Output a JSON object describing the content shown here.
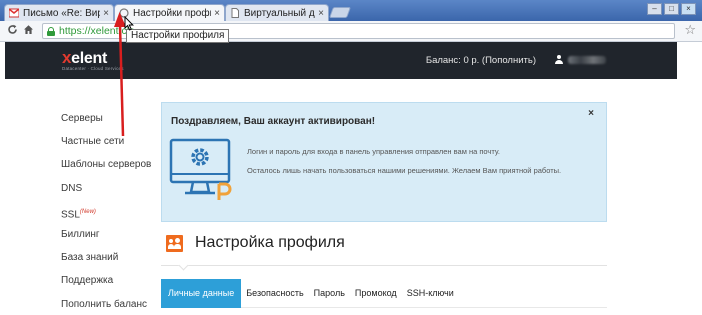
{
  "browser": {
    "tabs": [
      {
        "label": "Письмо «Re: Виртуа",
        "close": "×",
        "active": false
      },
      {
        "label": "Настройки профил",
        "close": "×",
        "active": true
      },
      {
        "label": "Виртуальный дата",
        "close": "×",
        "active": false
      }
    ],
    "window_buttons": {
      "minimize": "–",
      "maximize": "□",
      "close": "×"
    },
    "url": "https://xelent.clo",
    "tooltip": "Настройки профиля"
  },
  "site": {
    "logo_text": "elent",
    "logo_mark": "x",
    "logo_tagline": "Datacenter · Cloud Services",
    "balance_text": "Баланс: 0 р. (Пополнить)"
  },
  "sidebar": {
    "items": [
      {
        "label": "Серверы"
      },
      {
        "label": "Частные сети"
      },
      {
        "label": "Шаблоны серверов"
      },
      {
        "label": "DNS"
      },
      {
        "label": "SSL",
        "badge": "(New)"
      },
      {
        "label": "Биллинг"
      },
      {
        "label": "База знаний"
      },
      {
        "label": "Поддержка"
      },
      {
        "label": "Пополнить баланс"
      }
    ]
  },
  "alert": {
    "title": "Поздравляем, Ваш аккаунт активирован!",
    "close": "×",
    "line1": "Логин и пароль для входа в панель управления отправлен вам на почту.",
    "line2": "Осталось лишь начать пользоваться нашими решениями. Желаем Вам приятной работы."
  },
  "profile": {
    "title": "Настройка профиля",
    "tabs": [
      {
        "label": "Личные данные",
        "active": true
      },
      {
        "label": "Безопасность",
        "active": false
      },
      {
        "label": "Пароль",
        "active": false
      },
      {
        "label": "Промокод",
        "active": false
      },
      {
        "label": "SSH-ключи",
        "active": false
      }
    ]
  },
  "colors": {
    "header_bg": "#20252c",
    "accent_blue": "#2d9fd8",
    "alert_bg": "#d8ecf7",
    "orange": "#ef6b1e",
    "annotation_red": "#d81e1e"
  },
  "icons": [
    "gmail-icon",
    "page-icon",
    "reload-icon",
    "home-icon",
    "lock-icon",
    "star-icon",
    "user-icon",
    "gear-monitor-icon",
    "users-icon",
    "cursor-icon"
  ]
}
